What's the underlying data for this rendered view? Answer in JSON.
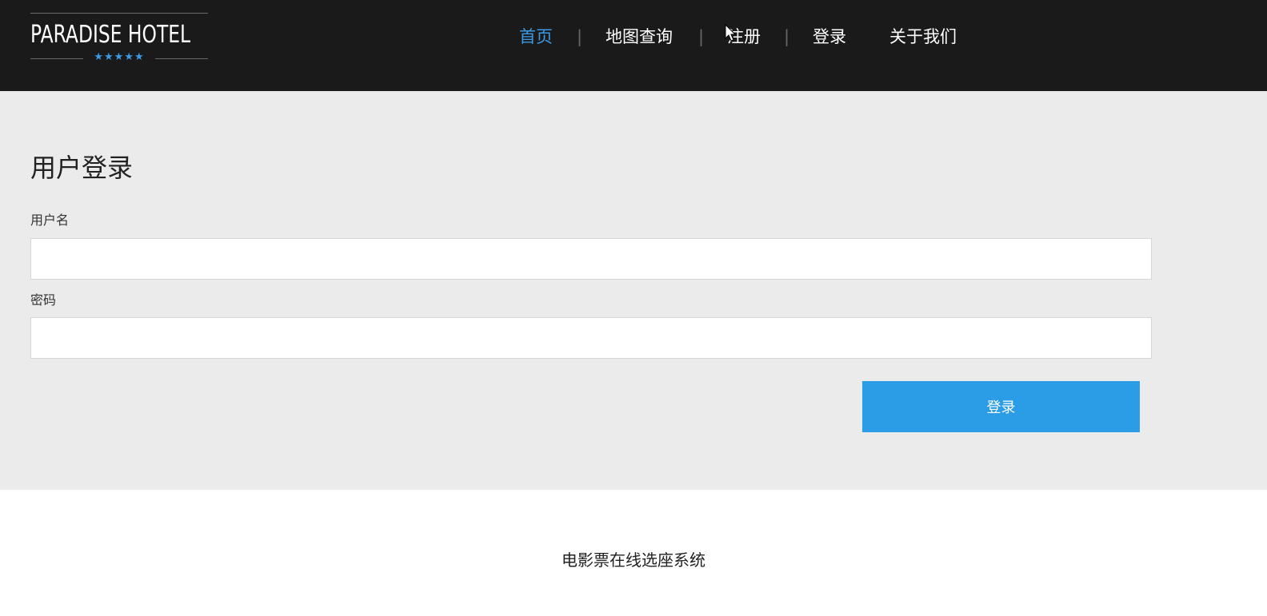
{
  "header": {
    "logo_text": "PARADISE HOTEL",
    "logo_stars": "★★★★★",
    "nav": {
      "home": "首页",
      "map": "地图查询",
      "register": "注册",
      "login": "登录",
      "about": "关于我们",
      "separator": "|"
    }
  },
  "login_form": {
    "title": "用户登录",
    "username_label": "用户名",
    "username_value": "",
    "password_label": "密码",
    "password_value": "",
    "submit_label": "登录"
  },
  "footer": {
    "text": "电影票在线选座系统"
  },
  "colors": {
    "header_bg": "#1a1a1a",
    "accent": "#2b9ce6",
    "main_bg": "#ebebeb"
  }
}
